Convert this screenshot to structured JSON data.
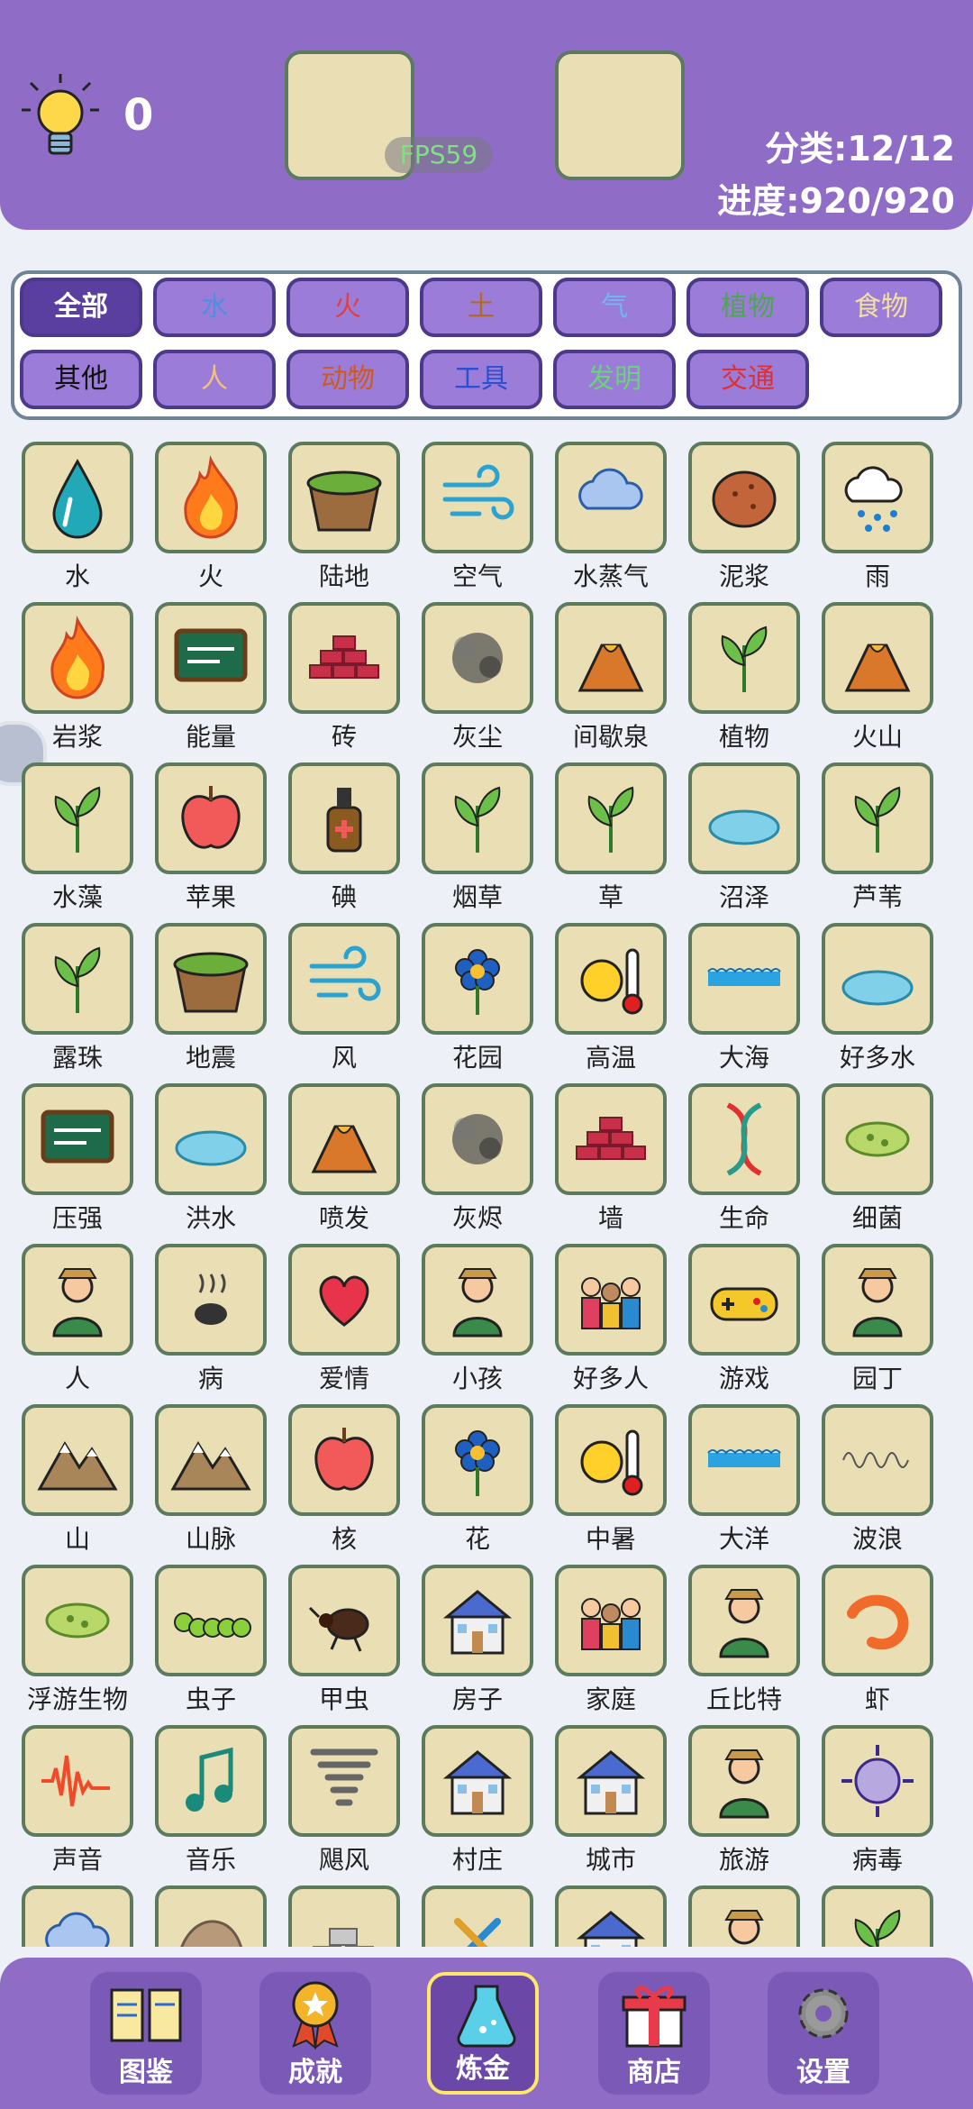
{
  "header": {
    "hint_count": "0",
    "fps": "FPS59",
    "category_progress": "分类:12/12",
    "progress": "进度:920/920"
  },
  "categories": [
    {
      "label": "全部",
      "color": "#ffffff",
      "selected": true
    },
    {
      "label": "水",
      "color": "#4f8fe0"
    },
    {
      "label": "火",
      "color": "#e04040"
    },
    {
      "label": "土",
      "color": "#b36a1f"
    },
    {
      "label": "气",
      "color": "#6fb8ef"
    },
    {
      "label": "植物",
      "color": "#4fa650"
    },
    {
      "label": "食物",
      "color": "#f2e0a0"
    },
    {
      "label": "其他",
      "color": "#111111"
    },
    {
      "label": "人",
      "color": "#f0c080"
    },
    {
      "label": "动物",
      "color": "#d05a1a"
    },
    {
      "label": "工具",
      "color": "#2a4fd0"
    },
    {
      "label": "发明",
      "color": "#6dd07a"
    },
    {
      "label": "交通",
      "color": "#e03030"
    }
  ],
  "elements": [
    {
      "label": "水",
      "icon": "water-drop-icon"
    },
    {
      "label": "火",
      "icon": "fire-icon"
    },
    {
      "label": "陆地",
      "icon": "land-icon"
    },
    {
      "label": "空气",
      "icon": "wind-air-icon"
    },
    {
      "label": "水蒸气",
      "icon": "steam-icon"
    },
    {
      "label": "泥浆",
      "icon": "mud-icon"
    },
    {
      "label": "雨",
      "icon": "rain-cloud-icon"
    },
    {
      "label": "岩浆",
      "icon": "lava-icon"
    },
    {
      "label": "能量",
      "icon": "emc2-board-icon"
    },
    {
      "label": "砖",
      "icon": "bricks-icon"
    },
    {
      "label": "灰尘",
      "icon": "dust-icon"
    },
    {
      "label": "间歇泉",
      "icon": "geyser-icon"
    },
    {
      "label": "植物",
      "icon": "plant-icon"
    },
    {
      "label": "火山",
      "icon": "volcano-icon"
    },
    {
      "label": "水藻",
      "icon": "algae-icon"
    },
    {
      "label": "苹果",
      "icon": "apple-icon"
    },
    {
      "label": "碘",
      "icon": "iodine-bottle-icon"
    },
    {
      "label": "烟草",
      "icon": "tobacco-leaf-icon"
    },
    {
      "label": "草",
      "icon": "grass-icon"
    },
    {
      "label": "沼泽",
      "icon": "swamp-icon"
    },
    {
      "label": "芦苇",
      "icon": "reed-icon"
    },
    {
      "label": "露珠",
      "icon": "dew-icon"
    },
    {
      "label": "地震",
      "icon": "earthquake-icon"
    },
    {
      "label": "风",
      "icon": "wind-cloud-icon"
    },
    {
      "label": "花园",
      "icon": "garden-icon"
    },
    {
      "label": "高温",
      "icon": "sun-thermometer-icon"
    },
    {
      "label": "大海",
      "icon": "sea-icon"
    },
    {
      "label": "好多水",
      "icon": "puddle-icon"
    },
    {
      "label": "压强",
      "icon": "psi-board-icon"
    },
    {
      "label": "洪水",
      "icon": "flood-icon"
    },
    {
      "label": "喷发",
      "icon": "eruption-icon"
    },
    {
      "label": "灰烬",
      "icon": "ash-icon"
    },
    {
      "label": "墙",
      "icon": "wall-icon"
    },
    {
      "label": "生命",
      "icon": "dna-icon"
    },
    {
      "label": "细菌",
      "icon": "bacteria-icon"
    },
    {
      "label": "人",
      "icon": "person-icon"
    },
    {
      "label": "病",
      "icon": "sickness-icon"
    },
    {
      "label": "爱情",
      "icon": "love-icon"
    },
    {
      "label": "小孩",
      "icon": "baby-icon"
    },
    {
      "label": "好多人",
      "icon": "crowd-icon"
    },
    {
      "label": "游戏",
      "icon": "gamepad-icon"
    },
    {
      "label": "园丁",
      "icon": "gardener-icon"
    },
    {
      "label": "山",
      "icon": "mountain-icon"
    },
    {
      "label": "山脉",
      "icon": "mountain-range-icon"
    },
    {
      "label": "核",
      "icon": "apple-core-icon"
    },
    {
      "label": "花",
      "icon": "flower-icon"
    },
    {
      "label": "中暑",
      "icon": "heatstroke-icon"
    },
    {
      "label": "大洋",
      "icon": "ocean-icon"
    },
    {
      "label": "波浪",
      "icon": "wave-icon"
    },
    {
      "label": "浮游生物",
      "icon": "plankton-icon"
    },
    {
      "label": "虫子",
      "icon": "caterpillar-icon"
    },
    {
      "label": "甲虫",
      "icon": "beetle-icon"
    },
    {
      "label": "房子",
      "icon": "house-icon"
    },
    {
      "label": "家庭",
      "icon": "family-icon"
    },
    {
      "label": "丘比特",
      "icon": "cupid-icon"
    },
    {
      "label": "虾",
      "icon": "shrimp-icon"
    },
    {
      "label": "声音",
      "icon": "sound-wave-icon"
    },
    {
      "label": "音乐",
      "icon": "music-notes-icon"
    },
    {
      "label": "飓风",
      "icon": "tornado-icon"
    },
    {
      "label": "村庄",
      "icon": "village-icon"
    },
    {
      "label": "城市",
      "icon": "city-building-icon"
    },
    {
      "label": "旅游",
      "icon": "traveler-icon"
    },
    {
      "label": "病毒",
      "icon": "virus-icon"
    },
    {
      "label": "",
      "icon": "cloud-icon"
    },
    {
      "label": "",
      "icon": "rock-icon"
    },
    {
      "label": "",
      "icon": "metal-bars-icon"
    },
    {
      "label": "",
      "icon": "tools-icon"
    },
    {
      "label": "",
      "icon": "farm-icon"
    },
    {
      "label": "",
      "icon": "farmer-icon"
    },
    {
      "label": "",
      "icon": "wheat-icon"
    }
  ],
  "bottom_nav": [
    {
      "label": "图鉴",
      "icon": "book-icon"
    },
    {
      "label": "成就",
      "icon": "medal-icon"
    },
    {
      "label": "炼金",
      "icon": "flask-icon",
      "active": true
    },
    {
      "label": "商店",
      "icon": "gift-icon"
    },
    {
      "label": "设置",
      "icon": "gear-icon"
    }
  ]
}
